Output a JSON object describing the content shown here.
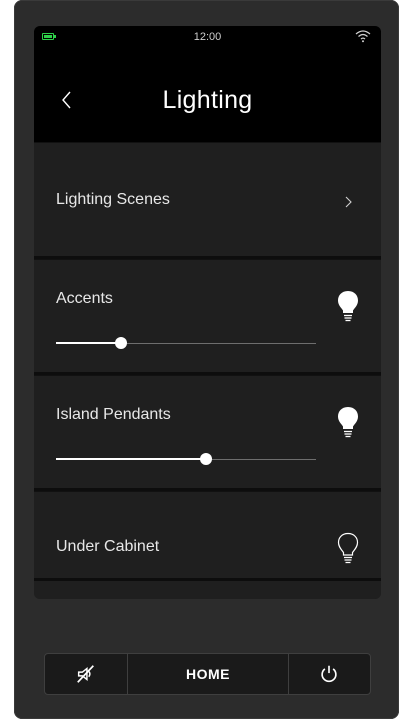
{
  "status_bar": {
    "time": "12:00",
    "battery_icon": "battery-icon",
    "wifi_icon": "wifi-icon",
    "battery_color": "#2fd14a"
  },
  "header": {
    "title": "Lighting",
    "back_icon": "chevron-left-icon"
  },
  "rows": [
    {
      "label": "Lighting Scenes",
      "type": "link",
      "icon": "chevron-right-icon"
    },
    {
      "label": "Accents",
      "type": "dimmer",
      "level": 0.25,
      "icon": "bulb-on-icon"
    },
    {
      "label": "Island Pendants",
      "type": "dimmer",
      "level": 0.575,
      "icon": "bulb-on-icon"
    },
    {
      "label": "Under Cabinet",
      "type": "switch",
      "state": "off",
      "icon": "bulb-off-icon"
    }
  ],
  "bottom_bar": {
    "mute_icon": "mute-icon",
    "home_label": "HOME",
    "power_icon": "power-icon"
  }
}
